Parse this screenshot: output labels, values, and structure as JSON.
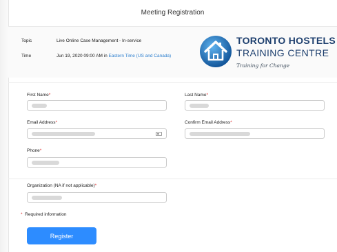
{
  "page": {
    "title": "Meeting Registration"
  },
  "meeting": {
    "topic_label": "Topic",
    "topic_value": "Live Online Case Management - In-service",
    "time_label": "Time",
    "time_value": "Jun 19, 2020 09:00 AM in ",
    "timezone": "Eastern Time (US and Canada)"
  },
  "brand": {
    "line1": "TORONTO HOSTELS",
    "line2": "TRAINING CENTRE",
    "tagline": "Training for Change",
    "colors": {
      "ring": "#1d6fb8",
      "navy": "#1d3f6e"
    }
  },
  "form": {
    "required_mark": "*",
    "first_name_label": "First Name",
    "last_name_label": "Last Name",
    "email_label": "Email Address",
    "confirm_email_label": "Confirm Email Address",
    "phone_label": "Phone",
    "organization_label": "Organization (NA if not applicable)",
    "email_field_icon": "contact-card-icon",
    "required_note": "Required information",
    "register_label": "Register"
  },
  "colors": {
    "accent": "#2d8cff",
    "required": "#e02828",
    "link": "#2d7fce"
  }
}
